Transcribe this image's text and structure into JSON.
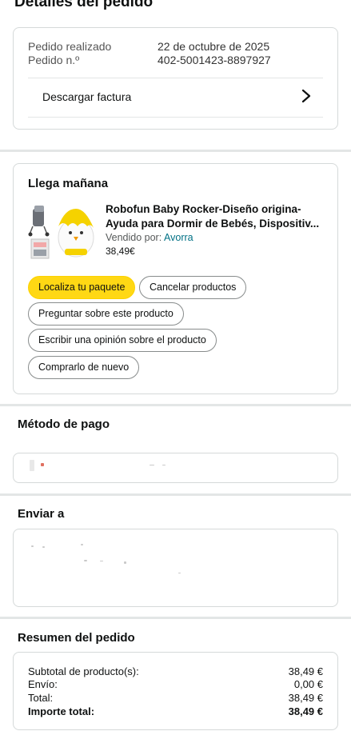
{
  "page_title": "Detalles del pedido",
  "order": {
    "placed_label": "Pedido realizado",
    "placed_value": "22 de octubre de 2025",
    "number_label": "Pedido n.º",
    "number_value": "402-5001423-8897927",
    "invoice_label": "Descargar factura"
  },
  "delivery": {
    "title": "Llega mañana",
    "product_title_line1": "Robofun Baby Rocker-Diseño origina-",
    "product_title_line2": "Ayuda para Dormir de Bebés, Dispositiv...",
    "seller_prefix": "Vendido por:",
    "seller_name": "Avorra",
    "price": "38,49€",
    "buttons": {
      "track": "Localiza tu paquete",
      "cancel": "Cancelar productos",
      "ask": "Preguntar sobre este producto",
      "review": "Escribir una opinión sobre el producto",
      "buy_again": "Comprarlo de nuevo"
    }
  },
  "payment": {
    "title": "Método de pago"
  },
  "shipping": {
    "title": "Enviar a"
  },
  "summary": {
    "title": "Resumen del pedido",
    "rows": [
      {
        "label": "Subtotal de producto(s):",
        "value": "38,49 €"
      },
      {
        "label": "Envío:",
        "value": "0,00 €"
      },
      {
        "label": "Total:",
        "value": "38,49 €"
      },
      {
        "label": "Importe total:",
        "value": "38,49 €"
      }
    ]
  },
  "colors": {
    "primary_button": "#ffd814",
    "link": "#007185",
    "border": "#d5d9d9"
  },
  "icons": [
    "chevron-right-icon",
    "product-thumbnail"
  ]
}
